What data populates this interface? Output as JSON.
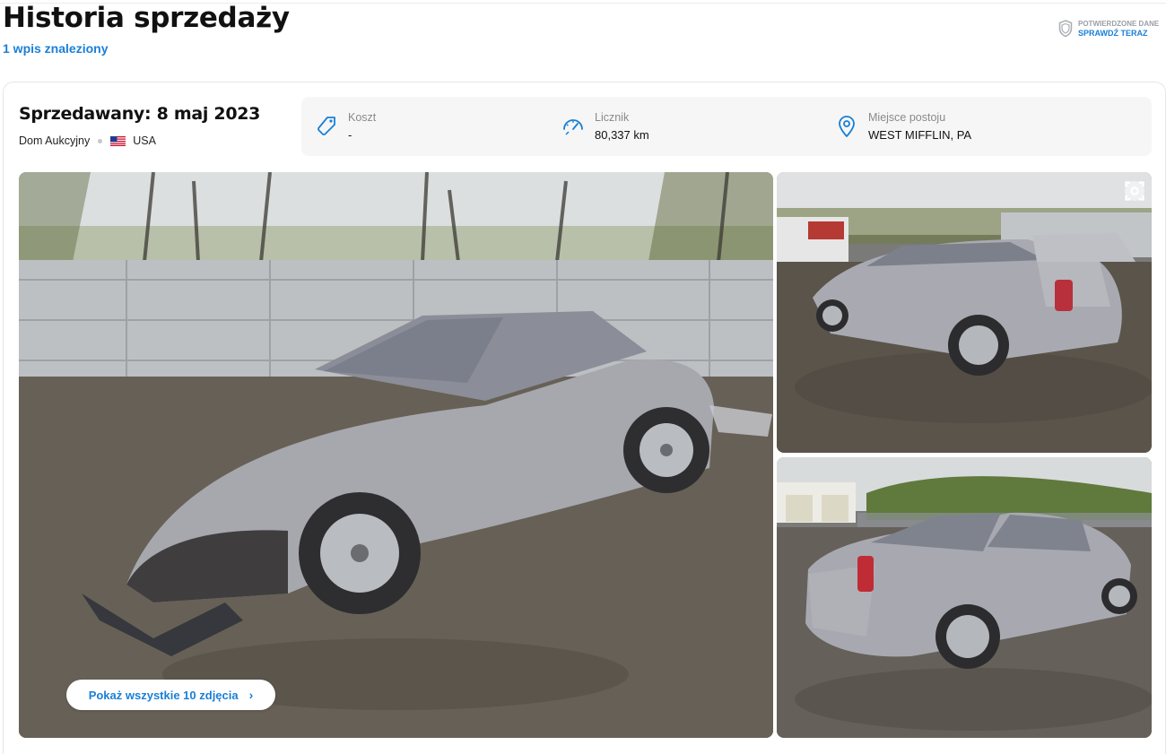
{
  "header": {
    "title": "Historia sprzedaży",
    "count_link": "1 wpis znaleziony",
    "verify": {
      "line1": "POTWIERDZONE DANE",
      "line2": "SPRAWDŹ TERAZ"
    }
  },
  "sale": {
    "title": "Sprzedawany: 8 maj 2023",
    "seller_type": "Dom Aukcyjny",
    "country": "USA",
    "info": [
      {
        "icon": "price-tag-icon",
        "label": "Koszt",
        "value": "-"
      },
      {
        "icon": "speedometer-icon",
        "label": "Licznik",
        "value": "80,337 km"
      },
      {
        "icon": "location-pin-icon",
        "label": "Miejsce postoju",
        "value": "WEST MIFFLIN, PA"
      }
    ],
    "gallery": {
      "show_all_label": "Pokaż wszystkie 10 zdjęcia"
    }
  },
  "colors": {
    "accent": "#1a7fd6",
    "muted": "#8a8a8a",
    "panel": "#f6f6f6"
  }
}
